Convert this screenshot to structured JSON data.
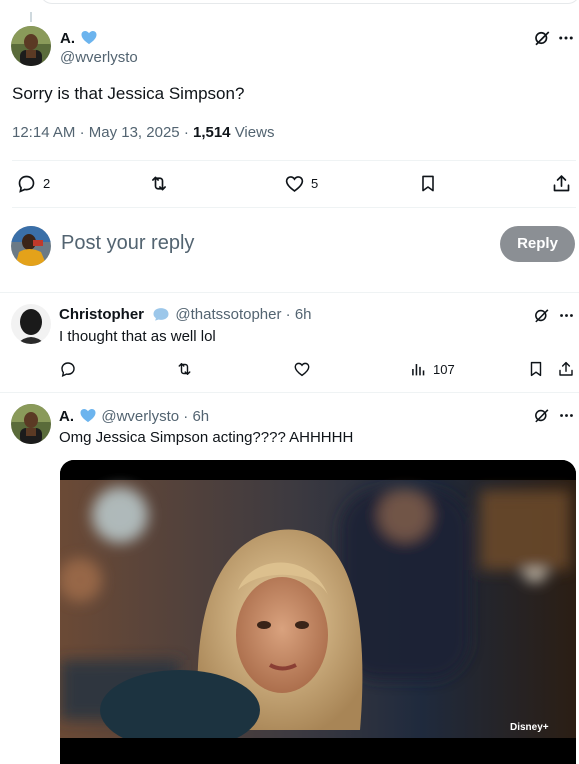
{
  "main_tweet": {
    "display_name": "A.",
    "handle": "@wverlysto",
    "text": "Sorry is that Jessica Simpson?",
    "time": "12:14 AM",
    "date": "May 13, 2025",
    "views_count": "1,514",
    "views_label": "Views",
    "actions": {
      "replies": "2",
      "likes": "5"
    }
  },
  "composer": {
    "placeholder": "Post your reply",
    "button_label": "Reply"
  },
  "replies": [
    {
      "display_name": "Christopher",
      "handle": "@thatssotopher",
      "age": "6h",
      "text": "I thought that as well lol",
      "views": "107"
    },
    {
      "display_name": "A.",
      "handle": "@wverlysto",
      "age": "6h",
      "text": "Omg Jessica Simpson acting???? AHHHHH",
      "media_watermark": "Disney+"
    }
  ],
  "icons": [
    "grok-icon",
    "more-icon",
    "reply-icon",
    "retweet-icon",
    "like-icon",
    "bookmark-icon",
    "share-icon",
    "views-icon",
    "verified-badge-icon"
  ],
  "colors": {
    "verified_blue": "#6cb4ee",
    "text_primary": "#0f1419",
    "text_secondary": "#536471",
    "reply_button_bg": "#8b8f94",
    "divider": "#eff3f4"
  }
}
